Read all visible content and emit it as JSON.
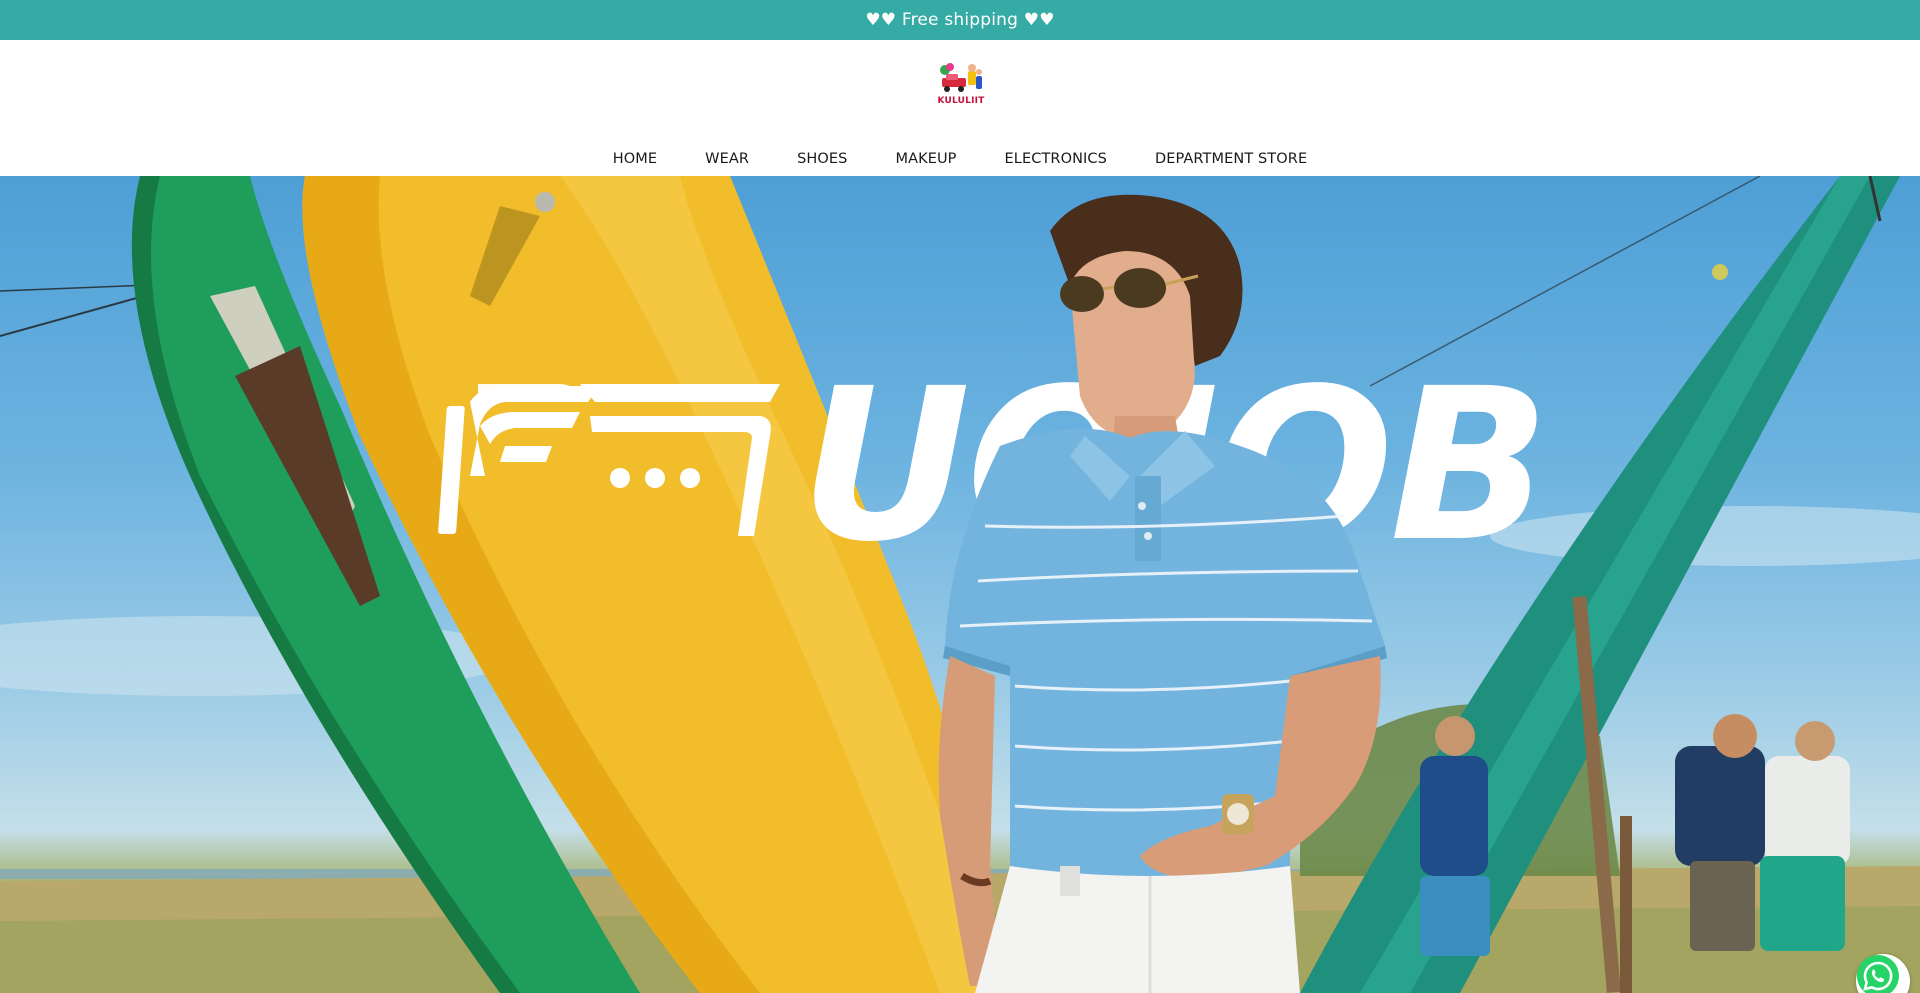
{
  "announcement": {
    "text": "♥♥ Free shipping ♥♥"
  },
  "header": {
    "logo_text": "KULULIIT",
    "nav": [
      {
        "label": "HOME"
      },
      {
        "label": "WEAR"
      },
      {
        "label": "SHOES"
      },
      {
        "label": "MAKEUP"
      },
      {
        "label": "ELECTRONICS"
      },
      {
        "label": "DEPARTMENT STORE"
      }
    ]
  },
  "hero": {
    "brand_text": "UOIOB"
  },
  "colors": {
    "accent": "#36aaa4",
    "logo_red": "#c0143c",
    "whatsapp_green": "#25d366"
  },
  "icons": {
    "whatsapp": "whatsapp-icon",
    "brand_logo": "brand-mark-icon"
  }
}
